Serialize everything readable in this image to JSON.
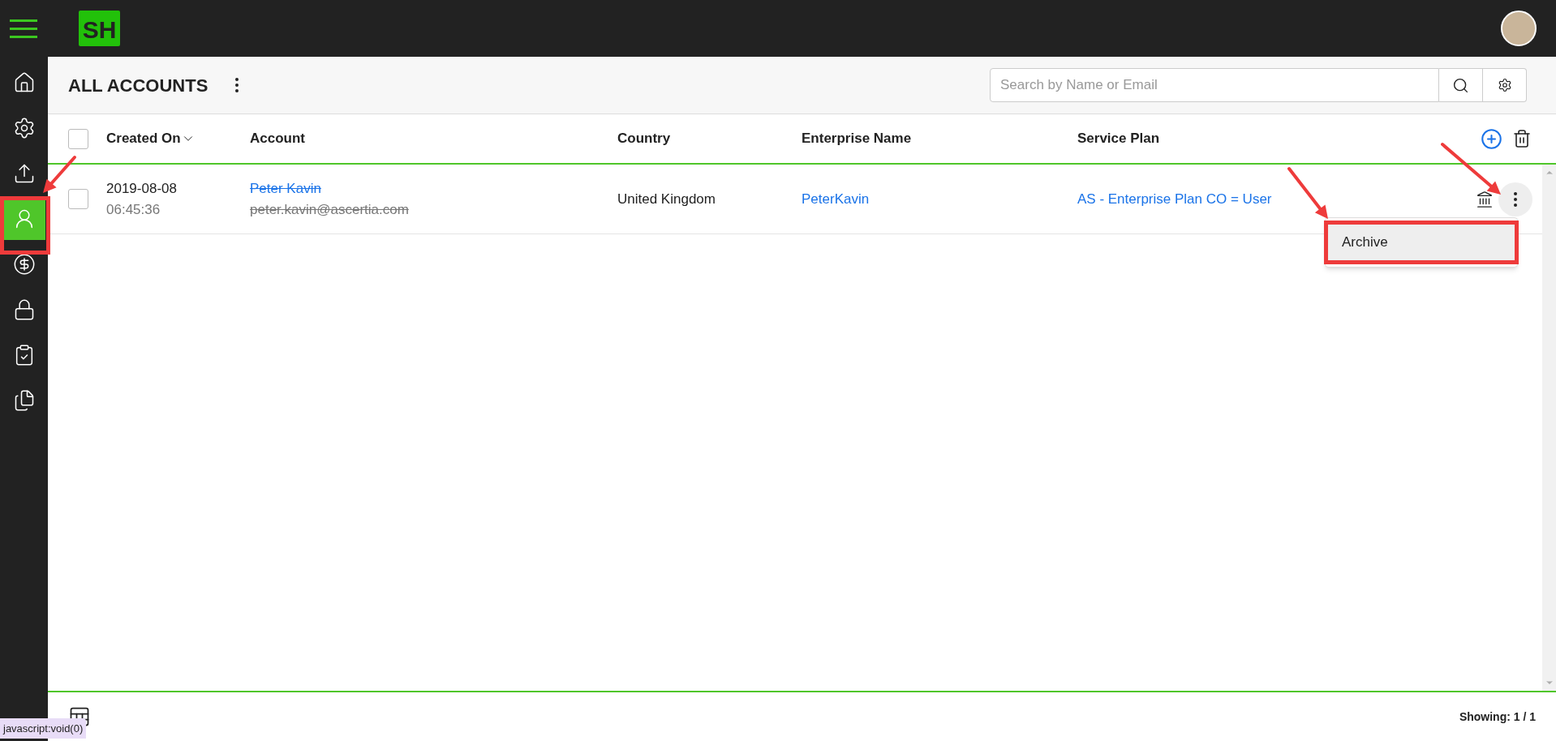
{
  "logo": "SH",
  "sidebar": {
    "items": [
      {
        "kind": "home",
        "selected": false
      },
      {
        "kind": "settings",
        "selected": false
      },
      {
        "kind": "upload",
        "selected": false
      },
      {
        "kind": "user",
        "selected": true
      },
      {
        "kind": "billing",
        "selected": false
      },
      {
        "kind": "security",
        "selected": false
      },
      {
        "kind": "checklist",
        "selected": false
      },
      {
        "kind": "documents",
        "selected": false
      }
    ]
  },
  "header": {
    "title": "ALL ACCOUNTS"
  },
  "search": {
    "placeholder": "Search by Name or Email"
  },
  "table": {
    "select_all": {
      "checked": false
    },
    "columns": [
      {
        "label": "Created On",
        "sorted": true
      },
      {
        "label": "Account",
        "sorted": false
      },
      {
        "label": "Country",
        "sorted": false
      },
      {
        "label": "Enterprise Name",
        "sorted": false
      },
      {
        "label": "Service Plan",
        "sorted": false
      }
    ],
    "rows": [
      {
        "checked": false,
        "date": "2019-08-08",
        "time": "06:45:36",
        "name": "Peter Kavin",
        "email": "peter.kavin@ascertia.com",
        "archived": true,
        "country": "United Kingdom",
        "enterprise": "PeterKavin",
        "service_plan": "AS - Enterprise Plan CO = User"
      }
    ]
  },
  "menu": {
    "items": [
      {
        "label": "Archive",
        "highlighted": true
      }
    ]
  },
  "footer": {
    "showing": "Showing: 1 / 1"
  },
  "status_tooltip": "javascript:void(0)"
}
